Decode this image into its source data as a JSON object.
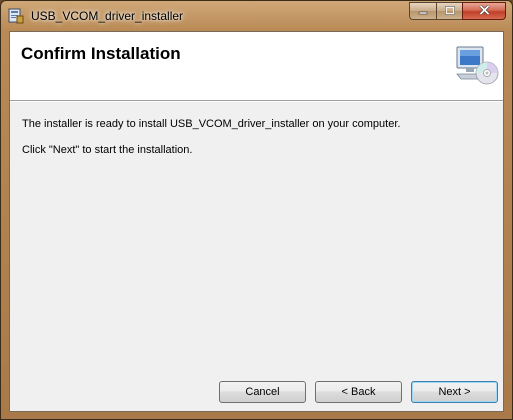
{
  "window": {
    "title": "USB_VCOM_driver_installer",
    "caption_icons": [
      "minimize-icon",
      "maximize-icon",
      "close-icon"
    ]
  },
  "banner": {
    "heading": "Confirm Installation",
    "icon": "computer-cd-icon"
  },
  "body": {
    "line1": "The installer is ready to install USB_VCOM_driver_installer on your computer.",
    "line2": "Click \"Next\" to start the installation."
  },
  "buttons": {
    "cancel": "Cancel",
    "back": "< Back",
    "next": "Next >"
  },
  "colors": {
    "frame": "#b98a55",
    "close_button": "#c0402a",
    "client_background": "#f0f0f0",
    "banner_background": "#ffffff"
  }
}
